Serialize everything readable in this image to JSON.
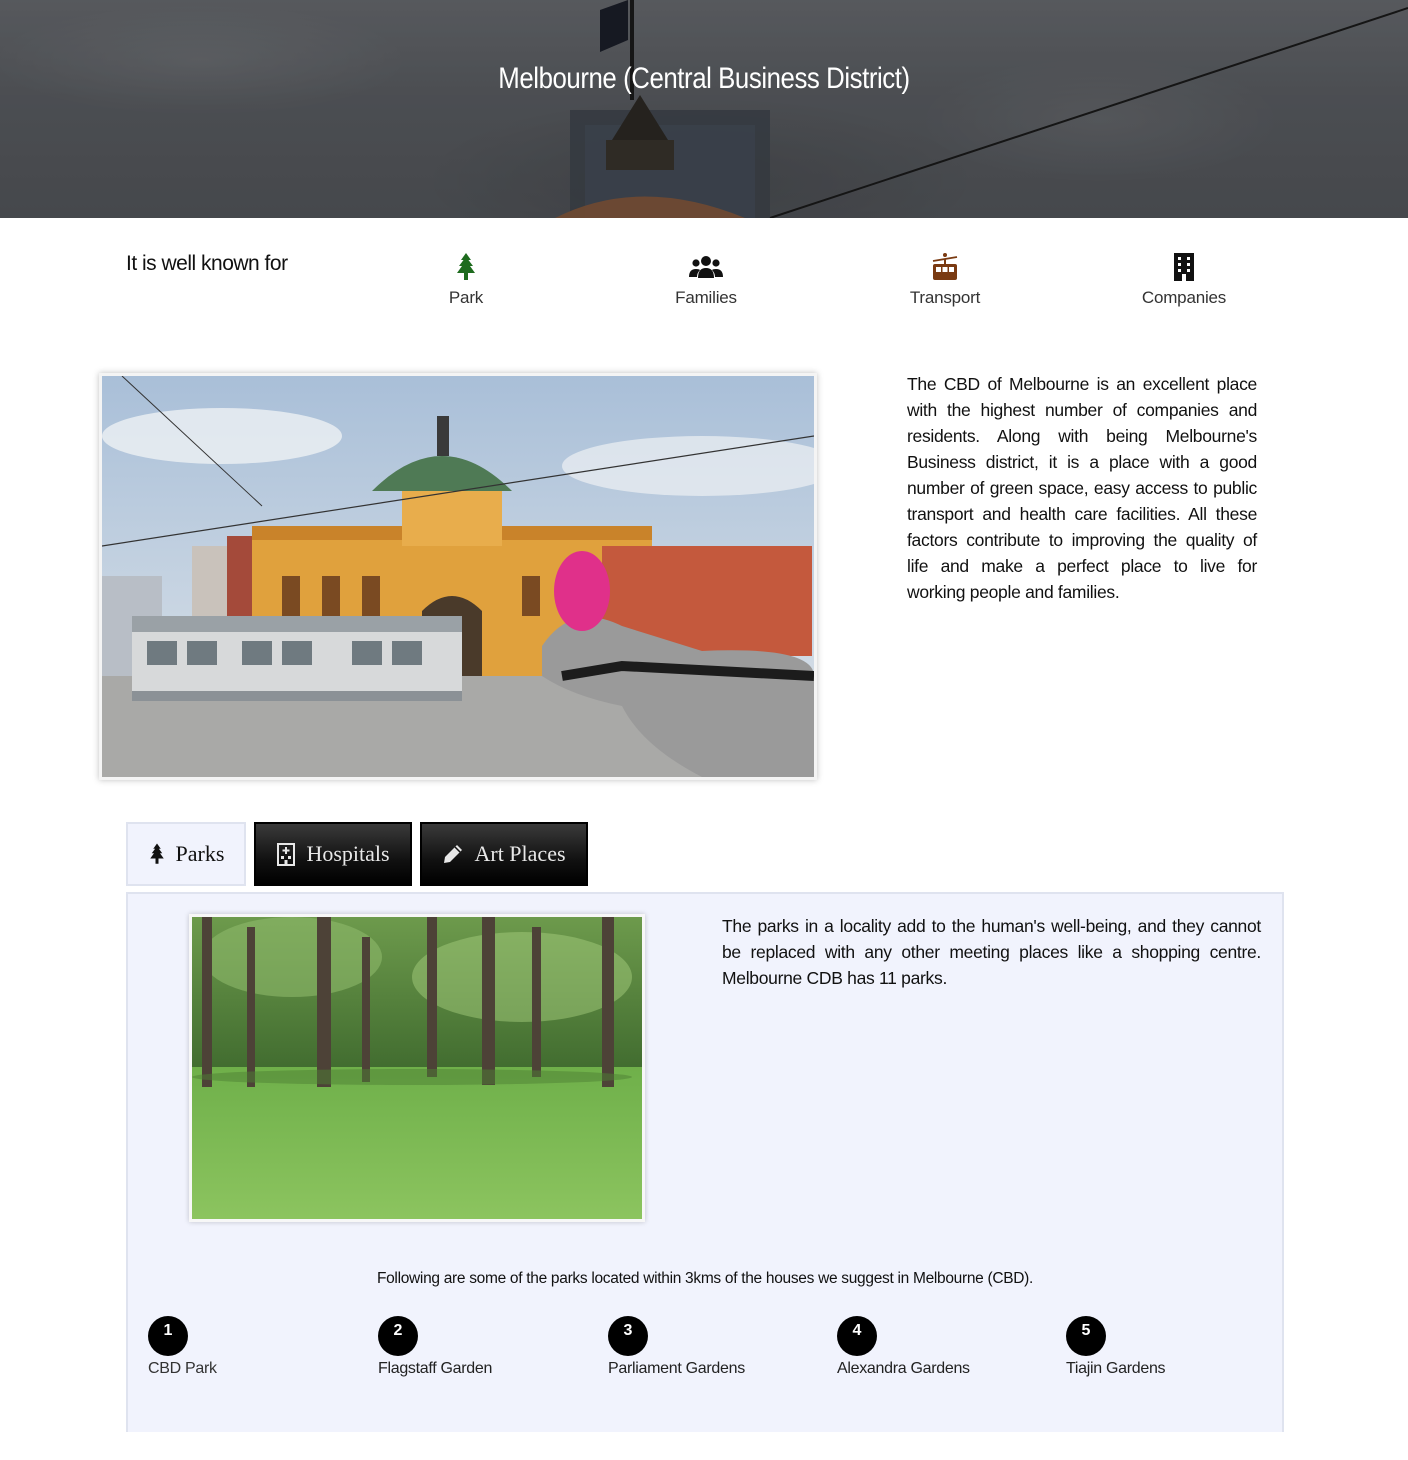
{
  "hero": {
    "title": "Melbourne (Central Business District)"
  },
  "known_for": {
    "label": "It is well known for",
    "features": [
      {
        "label": "Park",
        "icon": "tree-icon",
        "color": "#1e6b1e"
      },
      {
        "label": "Families",
        "icon": "users-icon",
        "color": "#111111"
      },
      {
        "label": "Transport",
        "icon": "cable-car-icon",
        "color": "#7a3a12"
      },
      {
        "label": "Companies",
        "icon": "building-icon",
        "color": "#111111"
      }
    ]
  },
  "intro": {
    "text": "The CBD of Melbourne is an excellent place with the highest number of companies and residents. Along with being Melbourne's Business district, it is a place with a good number of green space, easy access to public transport and health care facilities. All these factors contribute to improving the quality of life and make a perfect place to live for working people and families."
  },
  "tabs": [
    {
      "label": "Parks",
      "icon": "tree-icon",
      "active": true
    },
    {
      "label": "Hospitals",
      "icon": "hospital-icon",
      "active": false
    },
    {
      "label": "Art Places",
      "icon": "pencil-icon",
      "active": false
    }
  ],
  "parks_panel": {
    "description": "The parks in a locality add to the human's well-being, and they cannot be replaced with any other meeting places like a shopping centre. Melbourne CDB has 11 parks.",
    "list_intro": "Following are some of the parks located within 3kms of the houses we suggest in Melbourne (CBD).",
    "parks": [
      {
        "number": "1",
        "name": "CBD Park"
      },
      {
        "number": "2",
        "name": "Flagstaff Garden"
      },
      {
        "number": "3",
        "name": "Parliament Gardens"
      },
      {
        "number": "4",
        "name": "Alexandra Gardens"
      },
      {
        "number": "5",
        "name": "Tiajin Gardens"
      }
    ]
  }
}
